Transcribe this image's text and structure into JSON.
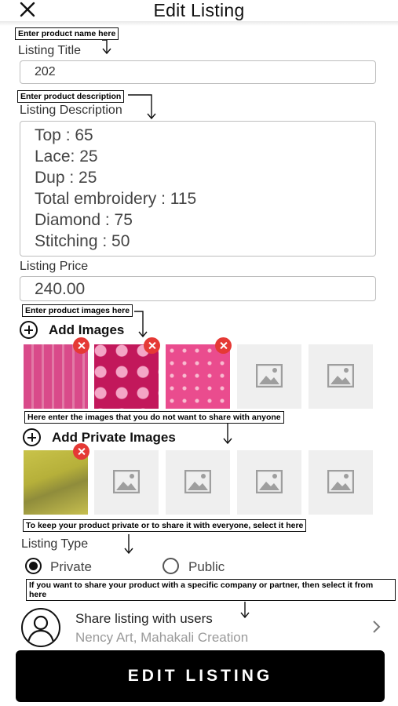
{
  "header": {
    "title": "Edit Listing"
  },
  "callouts": {
    "product_name": "Enter product name here",
    "product_description": "Enter product description",
    "product_images": "Enter product images here",
    "private_images": "Here enter the images that you do not want to share with anyone",
    "listing_type": "To keep your product private or to share it with everyone, select it here",
    "share": "If you want to share your product with a specific company or partner, then select it from here"
  },
  "form": {
    "title_label": "Listing Title",
    "title_value": "202",
    "description_label": "Listing Description",
    "description_lines": [
      "Top : 65",
      "Lace: 25",
      "Dup : 25",
      "Total embroidery : 115",
      "Diamond : 75",
      "Stitching : 50"
    ],
    "price_label": "Listing Price",
    "price_value": "240.00",
    "add_images_label": "Add Images",
    "add_private_images_label": "Add Private Images",
    "listing_type_label": "Listing Type",
    "listing_type_options": [
      "Private",
      "Public"
    ],
    "listing_type_selected": "Private"
  },
  "share": {
    "title": "Share listing with users",
    "users": "Nency Art, Mahakali Creation"
  },
  "submit_label": "EDIT LISTING",
  "colors": {
    "delete_badge": "#e53935",
    "button_bg": "#000000"
  },
  "icons": [
    "close-icon",
    "plus-circle-icon",
    "image-placeholder-icon",
    "delete-badge-icon",
    "user-avatar-icon",
    "chevron-right-icon"
  ]
}
